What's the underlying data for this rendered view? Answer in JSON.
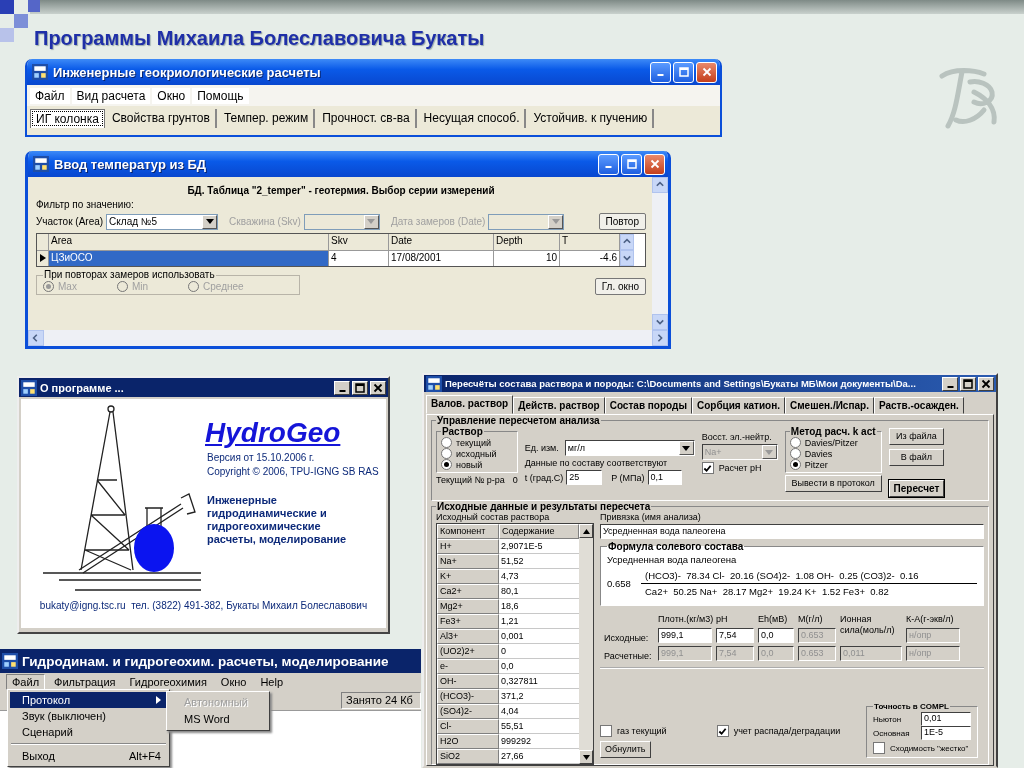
{
  "slide_title": "Программы Михаила Болеславовича Букаты",
  "window_geo": {
    "title": "Инженерные геокриологические расчеты",
    "menu": [
      "Файл",
      "Вид расчета",
      "Окно",
      "Помощь"
    ],
    "tabs": [
      {
        "label": "ИГ колонка",
        "selected": true
      },
      {
        "label": "Свойства грунтов",
        "selected": false
      },
      {
        "label": "Темпер. режим",
        "selected": false
      },
      {
        "label": "Прочност. св-ва",
        "selected": false
      },
      {
        "label": "Несущая способ.",
        "selected": false
      },
      {
        "label": "Устойчив. к пучению",
        "selected": false
      }
    ]
  },
  "window_db": {
    "title": "Ввод температур из БД",
    "heading": "БД. Таблица \"2_temper\" - геотермия. Выбор серии измерений",
    "filter_label": "Фильтр по значению:",
    "filters": [
      {
        "label": "Участок (Area)",
        "value": "Склад №5",
        "disabled": false
      },
      {
        "label": "Скважина (Skv)",
        "disabled": true
      },
      {
        "label": "Дата замеров (Date)",
        "disabled": true
      }
    ],
    "repeat_button": "Повтор",
    "table": {
      "columns": [
        "Area",
        "Skv",
        "Date",
        "Depth",
        "T"
      ],
      "rows": [
        {
          "cells": [
            "ЦЗиОСО",
            "4",
            "17/08/2001",
            "10",
            "-4.6"
          ],
          "selected": true
        }
      ]
    },
    "repeat_group": {
      "title": "При повторах замеров использовать",
      "disabled": true,
      "options": [
        {
          "label": "Max",
          "selected": true
        },
        {
          "label": "Min",
          "selected": false
        },
        {
          "label": "Среднее",
          "selected": false
        }
      ]
    },
    "main_button": "Гл. окно"
  },
  "window_about": {
    "title": "О программе ...",
    "product": "HydroGeo",
    "version": "Версия от 15.10.2006 г.",
    "copyright": "Copyright © 2006, TPU-IGNG SB RAS",
    "description": "Инженерные гидродинамические и гидрогеохимические расчеты, моделирование",
    "contact": "bukaty@igng.tsc.ru  тел. (3822) 491-382, Букаты Михаил Болеславович"
  },
  "window_hydro": {
    "title": "Гидродинам. и гидрогеохим. расчеты, моделирование",
    "menu": [
      {
        "label": "Файл",
        "selected": true
      },
      {
        "label": "Фильтрация",
        "selected": false
      },
      {
        "label": "Гидрогеохимия",
        "selected": false
      },
      {
        "label": "Окно",
        "selected": false
      },
      {
        "label": "Help",
        "selected": false
      }
    ],
    "status": "Занято 24 Кб",
    "file_menu": [
      [
        {
          "label": "Протокол",
          "submenu": true,
          "selected": true
        },
        {
          "label": "Звук (выключен)",
          "submenu": false,
          "selected": false
        },
        {
          "label": "Сценарий",
          "submenu": false,
          "selected": false
        }
      ],
      [
        {
          "label": "Выход",
          "shortcut": "Alt+F4",
          "submenu": false,
          "selected": false
        }
      ]
    ],
    "submenu": [
      {
        "label": "Автономный",
        "disabled": true
      },
      {
        "label": "MS Word",
        "disabled": false
      }
    ]
  },
  "window_recalc": {
    "title": "Пересчёты состава раствора и породы:  C:\\Documents and Settings\\Букаты МБ\\Мои документы\\Da...",
    "tabs": [
      {
        "label": "Валов. раствор",
        "selected": true
      },
      {
        "label": "Действ. раствор",
        "selected": false
      },
      {
        "label": "Состав породы",
        "selected": false
      },
      {
        "label": "Сорбция катион.",
        "selected": false
      },
      {
        "label": "Смешен./Испар.",
        "selected": false
      },
      {
        "label": "Раств.-осажден.",
        "selected": false
      }
    ],
    "control_group": "Управление пересчетом анализа",
    "solution": {
      "title": "Раствор",
      "options": [
        {
          "label": "текущий",
          "selected": false
        },
        {
          "label": "исходный",
          "selected": false
        },
        {
          "label": "новый",
          "selected": true
        }
      ]
    },
    "current_label": "Текущий № р-ра",
    "current_value": "0",
    "unit": {
      "label": "Ед. изм.",
      "value": "мг/л"
    },
    "conditions_label": "Данные по составу соответствуют",
    "temperature": {
      "label": "t (град.С)",
      "value": "25"
    },
    "pressure": {
      "label": "P (МПа)",
      "value": "0,1"
    },
    "neutrality": {
      "label": "Восст. эл.-нейтр.",
      "value": "Na+",
      "disabled": true
    },
    "calc_ph": {
      "label": "Расчет pH",
      "checked": true
    },
    "method": {
      "title": "Метод расч. k act",
      "options": [
        {
          "label": "Davies/Pitzer",
          "selected": false
        },
        {
          "label": "Davies",
          "selected": false
        },
        {
          "label": "Pitzer",
          "selected": true
        }
      ]
    },
    "buttons": [
      {
        "label": "Из файла",
        "kind": "normal"
      },
      {
        "label": "В файл",
        "kind": "normal"
      },
      {
        "label": "Вывести в протокол",
        "kind": "wide"
      },
      {
        "label": "Пересчет",
        "kind": "default"
      }
    ],
    "data_group": "Исходные данные и результаты пересчета",
    "composition_label": "Исходный состав раствора",
    "composition": {
      "columns": [
        "Компонент",
        "Содержание"
      ],
      "rows": [
        {
          "component": "H+",
          "content": "2,9071E-5"
        },
        {
          "component": "Na+",
          "content": "51,52"
        },
        {
          "component": "K+",
          "content": "4,73"
        },
        {
          "component": "Ca2+",
          "content": "80,1"
        },
        {
          "component": "Mg2+",
          "content": "18,6"
        },
        {
          "component": "Fe3+",
          "content": "1,21"
        },
        {
          "component": "Al3+",
          "content": "0,001"
        },
        {
          "component": "(UO2)2+",
          "content": "0"
        },
        {
          "component": "e-",
          "content": "0,0"
        },
        {
          "component": "OH-",
          "content": "0,327811"
        },
        {
          "component": "(HCO3)-",
          "content": "371,2"
        },
        {
          "component": "(SO4)2-",
          "content": "4,04"
        },
        {
          "component": "Cl-",
          "content": "55,51"
        },
        {
          "component": "H2O",
          "content": "999292"
        },
        {
          "component": "SiO2",
          "content": "27,66"
        }
      ]
    },
    "binding": {
      "label": "Привязка (имя анализа)",
      "value": "Усредненная вода палеогена"
    },
    "formula": {
      "title": "Формула солевого состава",
      "name": "Усредненная вода палеогена",
      "coefficient": "0.658",
      "numerator": "(HCO3)-  78.34 Cl-  20.16 (SO4)2-  1.08 OH-  0.25 (CO3)2-  0.16",
      "denominator": "Ca2+  50.25 Na+  28.17 Mg2+  19.24 K+  1.52 Fe3+  0.82"
    },
    "params": {
      "row_labels": [
        "Исходные:",
        "Расчетные:"
      ],
      "columns": [
        {
          "header": "Плотн.(кг/м3)",
          "cells": [
            {
              "value": "999,1",
              "disabled": false
            },
            {
              "value": "999,1",
              "disabled": true
            }
          ]
        },
        {
          "header": "pH",
          "cells": [
            {
              "value": "7,54",
              "disabled": false
            },
            {
              "value": "7,54",
              "disabled": true
            }
          ]
        },
        {
          "header": "Eh(мВ)",
          "cells": [
            {
              "value": "0,0",
              "disabled": false
            },
            {
              "value": "0,0",
              "disabled": true
            }
          ]
        },
        {
          "header": "M(г/л)",
          "cells": [
            {
              "value": "0.653",
              "disabled": true
            },
            {
              "value": "0.653",
              "disabled": true
            }
          ]
        },
        {
          "header": "Ионная сила(моль/л)",
          "cells": [
            {
              "value": "0,011",
              "disabled": true
            }
          ]
        },
        {
          "header": "К-А(г-экв/л)",
          "cells": [
            {
              "value": "н/опр",
              "disabled": true
            },
            {
              "value": "н/опр",
              "disabled": true
            }
          ]
        }
      ]
    },
    "checkboxes": [
      {
        "label": "газ текущий",
        "checked": false
      },
      {
        "label": "учет распада/деградации",
        "checked": true
      }
    ],
    "reset_button": "Обнулить",
    "precision": {
      "title": "Точность в COMPL",
      "fields": [
        {
          "label": "Ньютон",
          "value": "0,01"
        },
        {
          "label": "Основная",
          "value": "1E-5"
        }
      ],
      "strict": {
        "label": "Сходимость \"жестко\"",
        "checked": false
      }
    }
  }
}
